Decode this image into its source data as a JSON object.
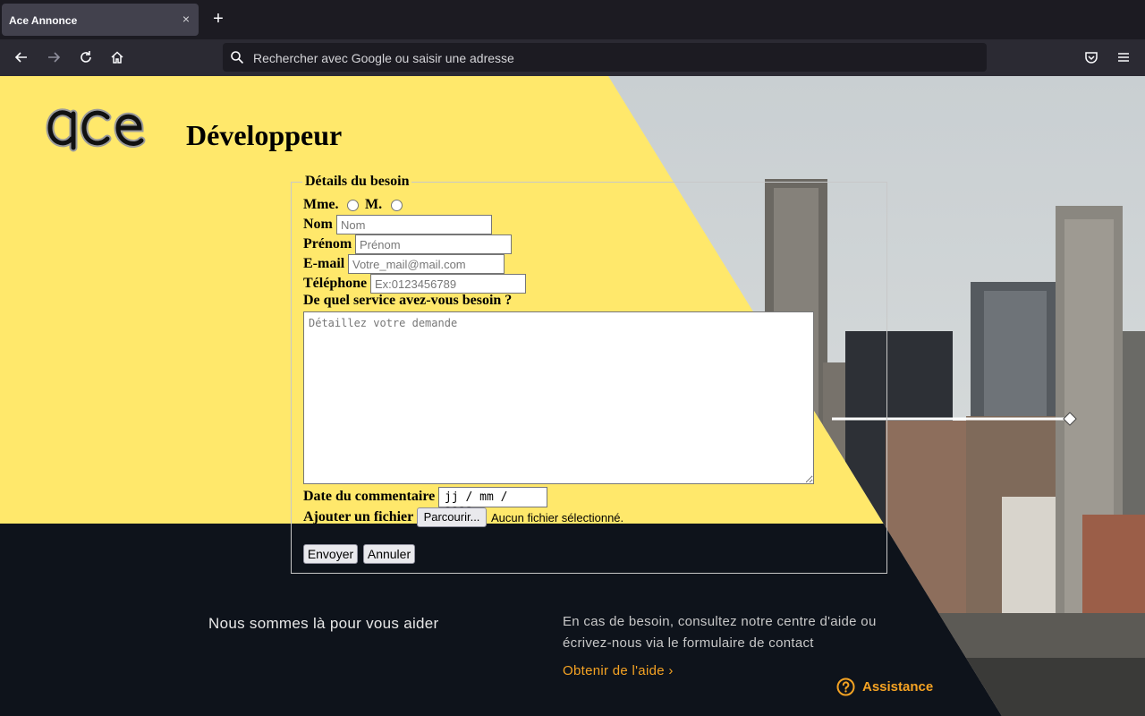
{
  "browser": {
    "tab_title": "Ace Annonce",
    "tab_close": "×",
    "new_tab": "+",
    "url_placeholder": "Rechercher avec Google ou saisir une adresse"
  },
  "header": {
    "logo_text": "ace",
    "title": "Développeur"
  },
  "form": {
    "legend": "Détails du besoin",
    "civility": {
      "mme_label": "Mme.",
      "m_label": "M."
    },
    "nom": {
      "label": "Nom",
      "placeholder": "Nom"
    },
    "prenom": {
      "label": "Prénom",
      "placeholder": "Prénom"
    },
    "email": {
      "label": "E-mail",
      "placeholder": "Votre_mail@mail.com"
    },
    "telephone": {
      "label": "Téléphone",
      "placeholder": "Ex:0123456789"
    },
    "service_question": "De quel service avez-vous besoin ?",
    "message_placeholder": "Détaillez votre demande",
    "date": {
      "label": "Date du commentaire",
      "placeholder": "jj / mm / aaaa"
    },
    "file": {
      "label": "Ajouter un fichier",
      "browse_label": "Parcourir...",
      "status": "Aucun fichier sélectionné."
    },
    "submit_label": "Envoyer",
    "reset_label": "Annuler"
  },
  "footer": {
    "help_title": "Nous sommes là pour vous aider",
    "help_text": "En cas de besoin, consultez notre centre d'aide ou écrivez-nous via le formulaire de contact",
    "help_link": "Obtenir de l'aide ›",
    "assistance_label": "Assistance"
  },
  "colors": {
    "yellow": "#ffe86b",
    "dark": "#0e131b",
    "accent": "#f5a323"
  }
}
